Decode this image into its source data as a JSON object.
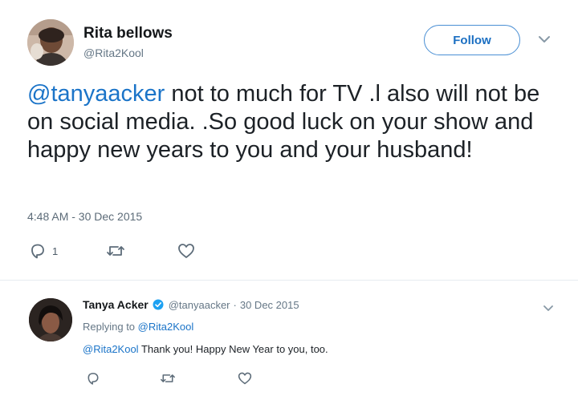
{
  "main_tweet": {
    "author_name": "Rita bellows",
    "author_handle": "@Rita2Kool",
    "follow_label": "Follow",
    "mention": "@tanyaacker",
    "text": " not to much for TV .l also will not be on social media. .So good luck on your show and happy new years to you and your husband!",
    "timestamp": "4:48 AM - 30 Dec 2015",
    "reply_count": "1",
    "icons": [
      "reply-icon",
      "retweet-icon",
      "like-icon",
      "chevron-down-icon"
    ]
  },
  "reply_tweet": {
    "author_name": "Tanya Acker",
    "verified": true,
    "author_handle": "@tanyaacker",
    "separator": "·",
    "date": "30 Dec 2015",
    "replying_prefix": "Replying to ",
    "replying_to": "@Rita2Kool",
    "mention": "@Rita2Kool",
    "text": " Thank you! Happy New Year to you, too.",
    "icons": [
      "reply-icon",
      "retweet-icon",
      "like-icon",
      "verified-badge-icon",
      "chevron-down-icon"
    ]
  },
  "colors": {
    "link": "#1b74c8",
    "secondary_text": "#657786",
    "follow_border": "#4a8fd4",
    "verified": "#1da1f2"
  }
}
